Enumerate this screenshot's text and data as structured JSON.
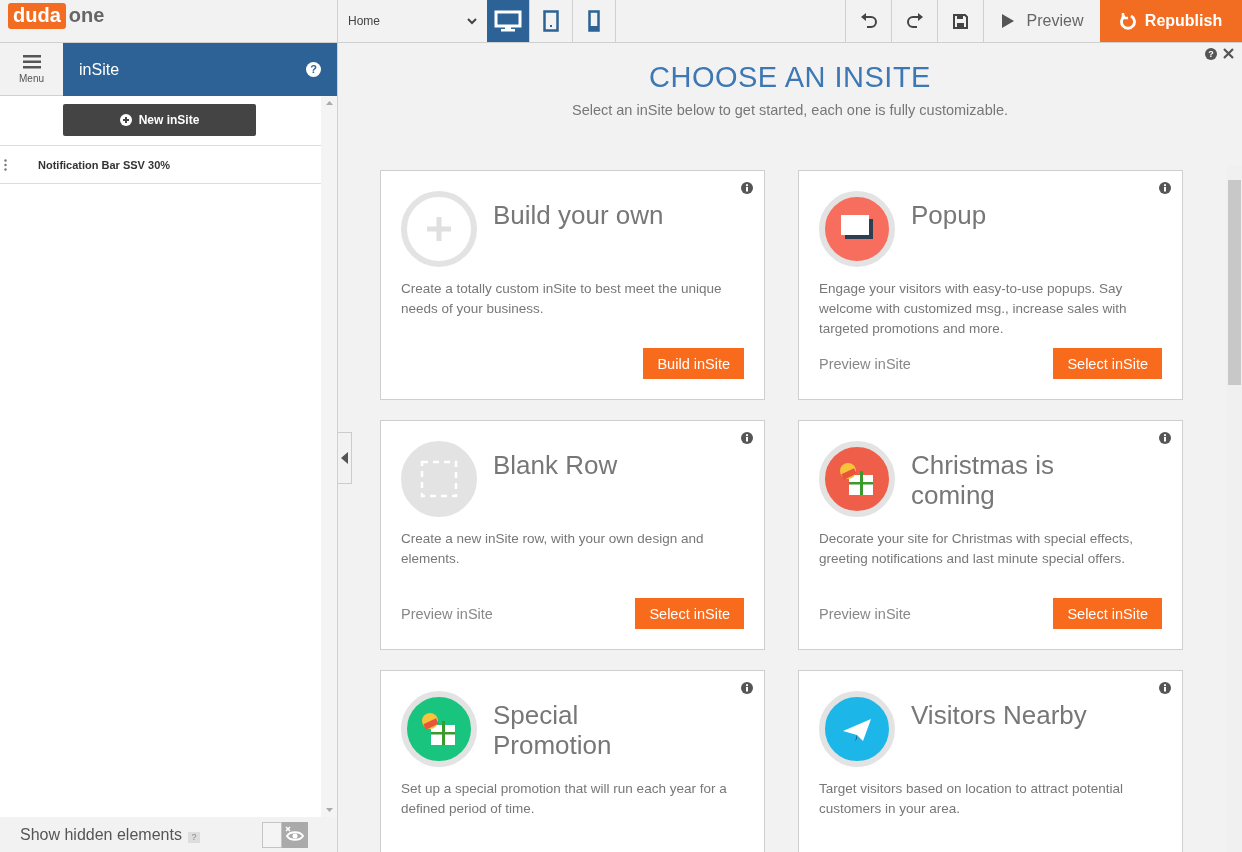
{
  "logo": {
    "brand": "duda",
    "suffix": "one"
  },
  "toolbar": {
    "page_select": "Home",
    "devices": [
      {
        "kind": "desktop",
        "selected": true
      },
      {
        "kind": "tablet",
        "selected": false
      },
      {
        "kind": "mobile",
        "selected": false
      }
    ],
    "preview": "Preview",
    "republish": "Republish"
  },
  "sidebar": {
    "menu_label": "Menu",
    "title": "inSite",
    "help": "?",
    "hidden_help": "?",
    "new_button": "New inSite",
    "items": [
      {
        "label": "Notification Bar SSV 30%"
      }
    ],
    "show_hidden": {
      "label": "Show hidden elements",
      "on": false
    }
  },
  "main": {
    "help": "?",
    "heading": "CHOOSE AN INSITE",
    "subheading": "Select an inSite below to get started, each one is fully customizable.",
    "cards": [
      {
        "kind": "plus",
        "title": "Build your own",
        "description": "Create a totally custom inSite to best meet the unique needs of your business.",
        "button": "Build inSite"
      },
      {
        "kind": "popup",
        "color": "#f76d5e",
        "title": "Popup",
        "description": "Engage your visitors with easy-to-use popups. Say welcome with customized msg., increase sales with targeted promotions and more.",
        "preview": "Preview inSite",
        "button": "Select inSite"
      },
      {
        "kind": "blank",
        "color": "#e3e3e3",
        "title": "Blank Row",
        "description": "Create a new inSite row, with your own design and elements.",
        "preview": "Preview inSite",
        "button": "Select inSite"
      },
      {
        "kind": "gift",
        "color": "#ee5e49",
        "title": "Christmas is coming",
        "description": "Decorate your site for Christmas with special effects, greeting notifications and last minute special offers.",
        "preview": "Preview inSite",
        "button": "Select inSite"
      },
      {
        "kind": "promo",
        "color": "#18c47e",
        "title": "Special Promotion",
        "description": "Set up a special promotion that will run each year for a defined period of time."
      },
      {
        "kind": "plane",
        "color": "#1cb7e8",
        "title": "Visitors Nearby",
        "description": "Target visitors based on location to attract potential customers in your area."
      }
    ]
  }
}
